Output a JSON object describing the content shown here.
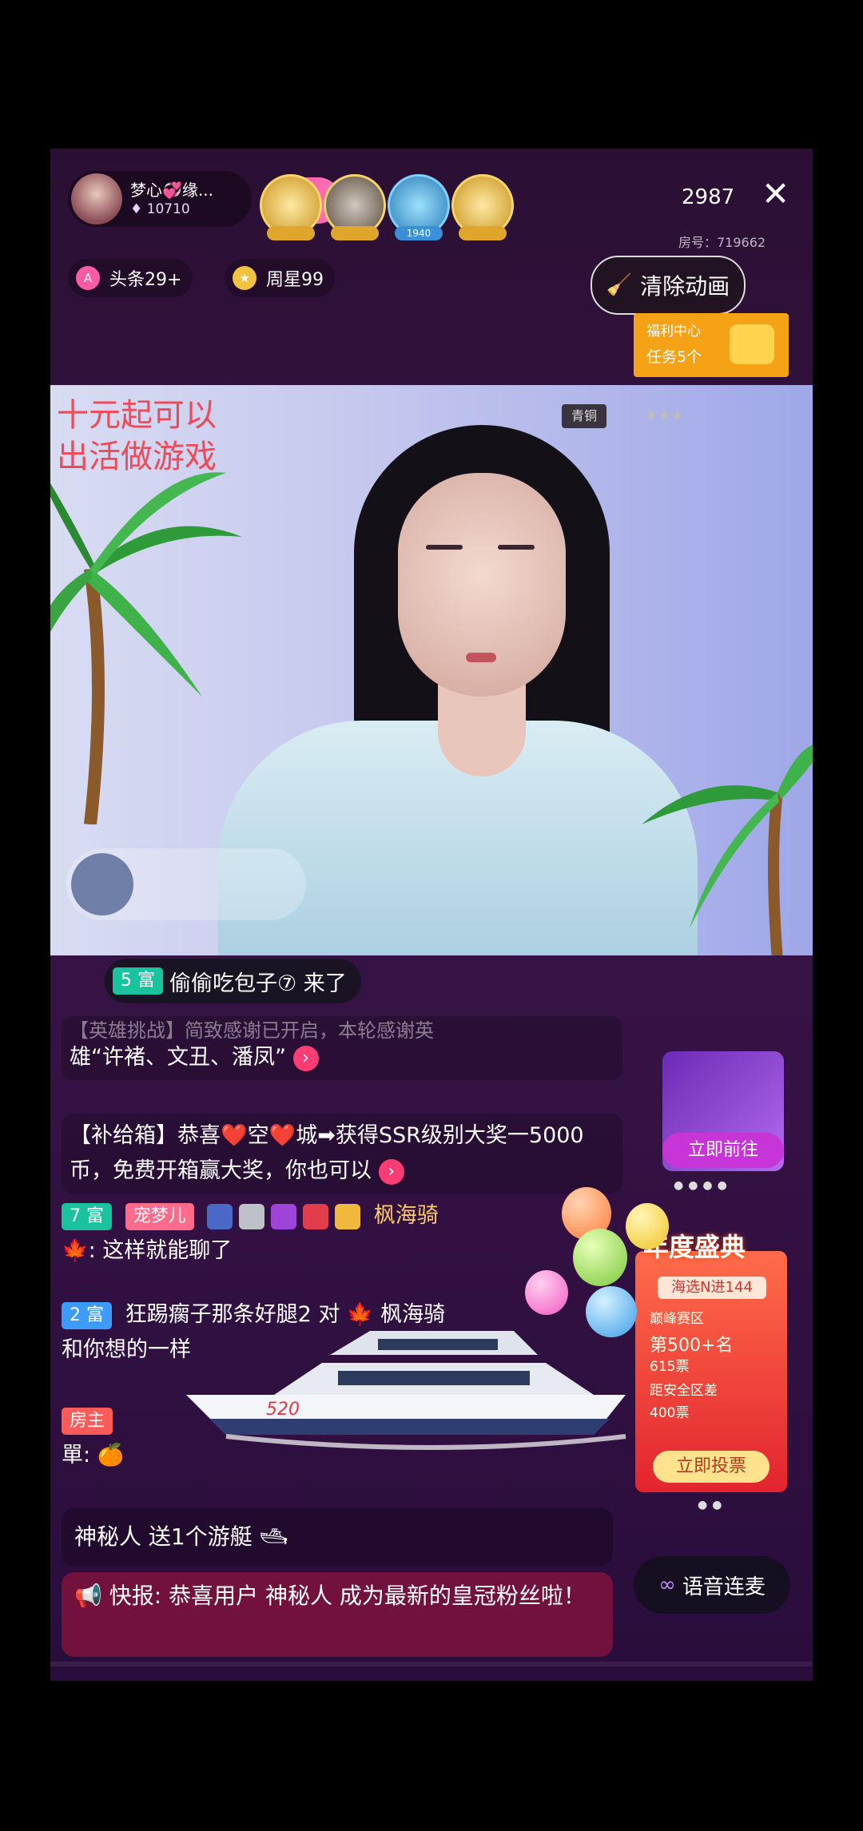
{
  "header": {
    "host_name": "梦心💞缘...",
    "host_fans": "10710",
    "follow_icon": "heart-follow",
    "viewer_count": "2987",
    "room_id": "房号：719662",
    "rank_tags": [
      "",
      "",
      "1940",
      ""
    ]
  },
  "pills": {
    "headline": "头条29+",
    "weekly_star": "周星99"
  },
  "clear_animation": "清除动画",
  "welfare": {
    "title": "福利中心",
    "tasks": "任务5个"
  },
  "video": {
    "watermark_line1": "十元起可以",
    "watermark_line2": "出活做游戏",
    "level_tag": "青铜",
    "stars": "★★★"
  },
  "chat": {
    "entry": {
      "badge": "5 富",
      "text": "偷偷吃包子⑦ 来了"
    },
    "sys1": {
      "text_top": "【英雄挑战】简致感谢已开启，本轮感谢英",
      "text": "雄“许褚、文丑、潘凤”"
    },
    "sys2": {
      "text": "【补给箱】恭喜❤️空❤️城➡获得SSR级别大奖一5000币，免费开箱赢大奖，你也可以"
    },
    "msg1": {
      "badge": "7 富",
      "tag": "宠梦儿",
      "name": "枫海骑",
      "text": "🍁: 这样就能聊了"
    },
    "msg2": {
      "badge": "2 富",
      "text": "狂踢瘸子那条好腿2 对 🍁 枫海骑",
      "text2": "和你想的一样"
    },
    "msg3": {
      "badge": "房主",
      "text": "單: 🍊"
    },
    "gift": "神秘人 送1个游艇",
    "flash": "📢 快报: 恭喜用户 神秘人 成为最新的皇冠粉丝啦！"
  },
  "voice_button": "语音连麦",
  "promo1": {
    "button": "立即前往"
  },
  "promo2": {
    "title": "年度盛典",
    "sub": "海选N进144",
    "ln1": "巅峰赛区",
    "ln2": "第500+名",
    "ln3": "615票",
    "ln4": "距安全区差",
    "ln5": "400票",
    "vote": "立即投票"
  },
  "gift_anim": {
    "yacht_label": "520"
  }
}
